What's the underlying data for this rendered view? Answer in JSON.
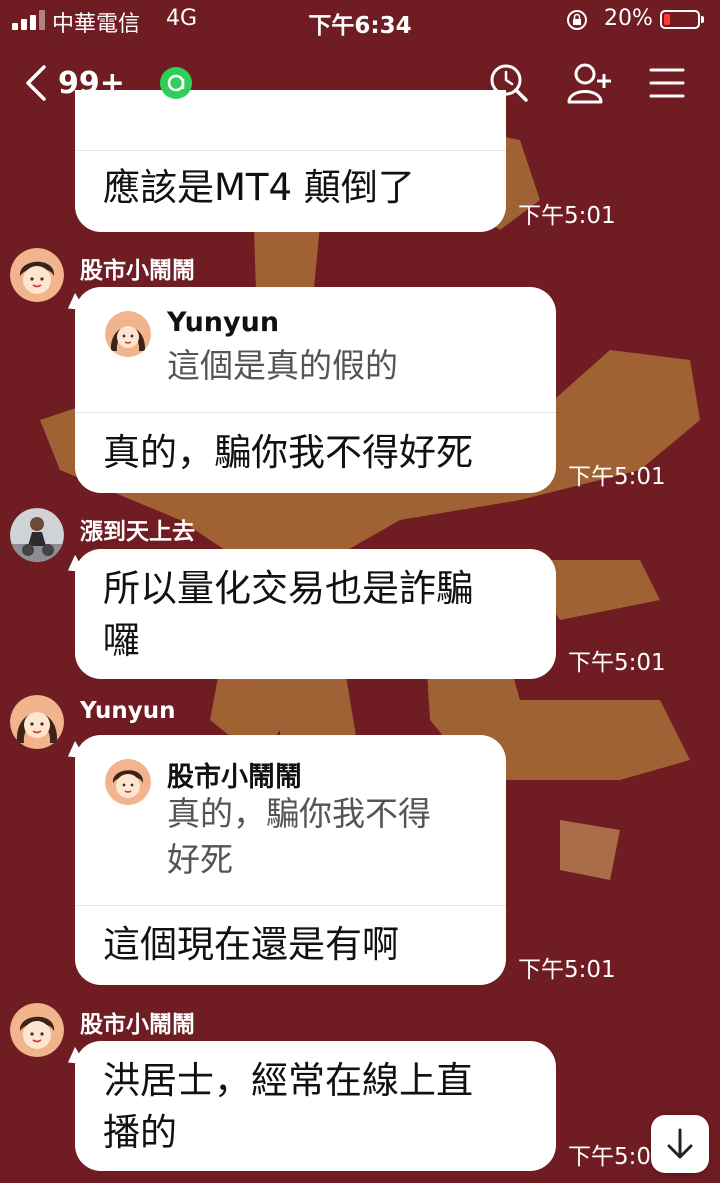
{
  "status_bar": {
    "carrier": "中華電信",
    "network": "4G",
    "time": "下午6:34",
    "battery_percent": "20%",
    "battery_level": 0.2,
    "icons": [
      "signal-icon",
      "orientation-lock-icon",
      "battery-icon"
    ]
  },
  "nav": {
    "unread_count": "99+",
    "icons": [
      "back-chevron-icon",
      "online-status-icon",
      "search-icon",
      "add-friend-icon",
      "menu-icon"
    ]
  },
  "messages": [
    {
      "id": "m1",
      "text": "應該是MT4 顛倒了",
      "time": "下午5:01"
    },
    {
      "id": "m2",
      "sender": "股市小鬧鬧",
      "reply": {
        "name": "Yunyun",
        "text": "這個是真的假的"
      },
      "text": "真的，騙你我不得好死",
      "time": "下午5:01"
    },
    {
      "id": "m3",
      "sender": "漲到天上去",
      "text": "所以量化交易也是詐騙\n囉",
      "time": "下午5:01"
    },
    {
      "id": "m4",
      "sender": "Yunyun",
      "reply": {
        "name": "股市小鬧鬧",
        "text": "真的，騙你我不得\n好死"
      },
      "text": "這個現在還是有啊",
      "time": "下午5:01"
    },
    {
      "id": "m5",
      "sender": "股市小鬧鬧",
      "text": "洪居士，經常在線上直\n播的",
      "time": "下午5:0"
    }
  ],
  "colors": {
    "background": "#6f1c22",
    "bubble": "#ffffff",
    "online_green": "#2fcf5a",
    "battery_red": "#ff3b30"
  }
}
